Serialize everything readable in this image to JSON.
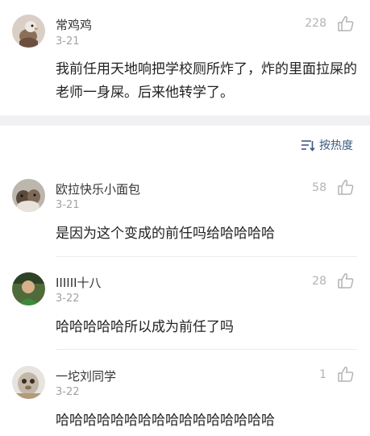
{
  "main_comment": {
    "username": "常鸡鸡",
    "date": "3-21",
    "likes": "228",
    "text": "我前任用天地响把学校厕所炸了，炸的里面拉屎的老师一身屎。后来他转学了。"
  },
  "sort": {
    "label": "按热度",
    "icon": "sort-lines-icon"
  },
  "replies": [
    {
      "username": "欧拉快乐小面包",
      "date": "3-21",
      "likes": "58",
      "text": "是因为这个变成的前任吗给哈哈哈哈"
    },
    {
      "username": "IIIIII十八",
      "date": "3-22",
      "likes": "28",
      "text": "哈哈哈哈哈所以成为前任了吗"
    },
    {
      "username": "一坨刘同学",
      "date": "3-22",
      "likes": "1",
      "text": "哈哈哈哈哈哈哈哈哈哈哈哈哈哈哈哈"
    }
  ],
  "colors": {
    "accent": "#3d5a80",
    "meta": "#a3a3a3",
    "separator_band": "#f1f1f3"
  }
}
